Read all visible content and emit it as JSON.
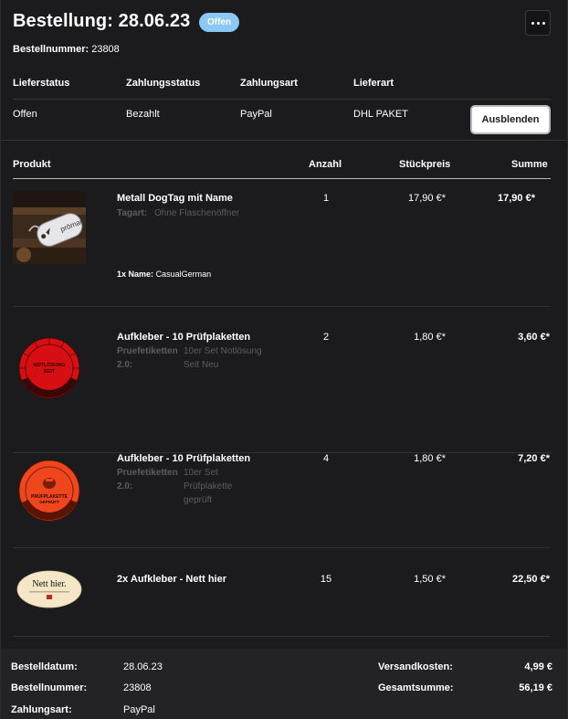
{
  "header": {
    "title": "Bestellung: 28.06.23",
    "status_badge": "Offen",
    "order_number_label": "Bestellnummer:",
    "order_number": "23808"
  },
  "status_table": {
    "headers": [
      "Lieferstatus",
      "Zahlungsstatus",
      "Zahlungsart",
      "Lieferart"
    ],
    "values": [
      "Offen",
      "Bezahlt",
      "PayPal",
      "DHL PAKET"
    ],
    "hide_button_label": "Ausblenden"
  },
  "products": {
    "headers": {
      "product": "Produkt",
      "quantity": "Anzahl",
      "unit_price": "Stückpreis",
      "total": "Summe"
    },
    "items": [
      {
        "name": "Metall DogTag mit Name",
        "image_icon": "dogtag-photo",
        "option_label": "Tagart:",
        "option_value": "Ohne Flaschenöffner",
        "extra_qty": "1x",
        "extra_label": "Name:",
        "extra_value": "CasualGerman",
        "quantity": "1",
        "unit_price": "17,90 €*",
        "total": "17,90 €*"
      },
      {
        "name": "Aufkleber - 10 Prüfplaketten",
        "image_icon": "red-inspection-sticker",
        "image_text_1": "NOTLÖSUNG",
        "image_text_2": "SEIT",
        "option_label_1": "Pruefetiketten",
        "option_label_2": "2.0:",
        "option_value_1": "10er Set Notlösung",
        "option_value_2": "Seit Neu",
        "quantity": "2",
        "unit_price": "1,80 €*",
        "total": "3,60 €*"
      },
      {
        "name": "Aufkleber - 10 Prüfplaketten",
        "image_icon": "orange-inspection-sticker",
        "image_text_1": "PRÜFPLAKETTE",
        "image_text_2": "GEPRÜFT",
        "option_label_1": "Pruefetiketten",
        "option_label_2": "2.0:",
        "option_value_1": "10er Set",
        "option_value_2": "Prüfplakette",
        "option_value_3": "geprüft",
        "quantity": "4",
        "unit_price": "1,80 €*",
        "total": "7,20 €*"
      },
      {
        "name": "2x Aufkleber - Nett hier",
        "image_icon": "nett-hier-sticker",
        "image_text": "Nett hier.",
        "quantity": "15",
        "unit_price": "1,50 €*",
        "total": "22,50 €*"
      }
    ]
  },
  "footer": {
    "left": [
      {
        "label": "Bestelldatum:",
        "value": "28.06.23"
      },
      {
        "label": "Bestellnummer:",
        "value": "23808"
      },
      {
        "label": "Zahlungsart:",
        "value": "PayPal"
      }
    ],
    "right": [
      {
        "label": "Versandkosten:",
        "value": "4,99 €"
      },
      {
        "label": "Gesamtsumme:",
        "value": "56,19 €"
      }
    ]
  },
  "colors": {
    "background": "#1b1b1d",
    "badge": "#8cc8f5",
    "footer_bg": "#232326",
    "muted_text": "#5c5c62"
  }
}
